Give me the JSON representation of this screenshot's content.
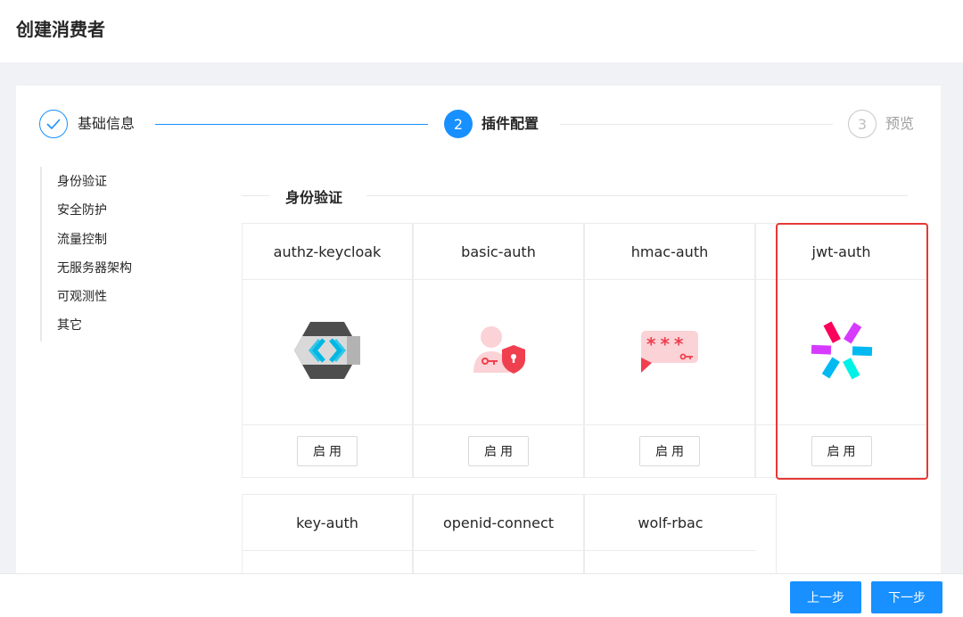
{
  "page": {
    "title": "创建消费者"
  },
  "steps": [
    {
      "number": "",
      "label": "基础信息",
      "status": "finished"
    },
    {
      "number": "2",
      "label": "插件配置",
      "status": "active"
    },
    {
      "number": "3",
      "label": "预览",
      "status": "waiting"
    }
  ],
  "sidebar": {
    "items": [
      {
        "label": "身份验证"
      },
      {
        "label": "安全防护"
      },
      {
        "label": "流量控制"
      },
      {
        "label": "无服务器架构"
      },
      {
        "label": "可观测性"
      },
      {
        "label": "其它"
      }
    ]
  },
  "section": {
    "title": "身份验证"
  },
  "plugins": [
    {
      "name": "authz-keycloak",
      "button": "启用"
    },
    {
      "name": "basic-auth",
      "button": "启用"
    },
    {
      "name": "hmac-auth",
      "button": "启用"
    },
    {
      "name": "jwt-auth",
      "button": "启用"
    },
    {
      "name": "key-auth",
      "button": ""
    },
    {
      "name": "openid-connect",
      "button": ""
    },
    {
      "name": "wolf-rbac",
      "button": ""
    }
  ],
  "hmac_icon_text": "***",
  "footer": {
    "prev_label": "上一步",
    "next_label": "下一步"
  },
  "colors": {
    "primary": "#1890ff",
    "highlight": "#e53935"
  }
}
